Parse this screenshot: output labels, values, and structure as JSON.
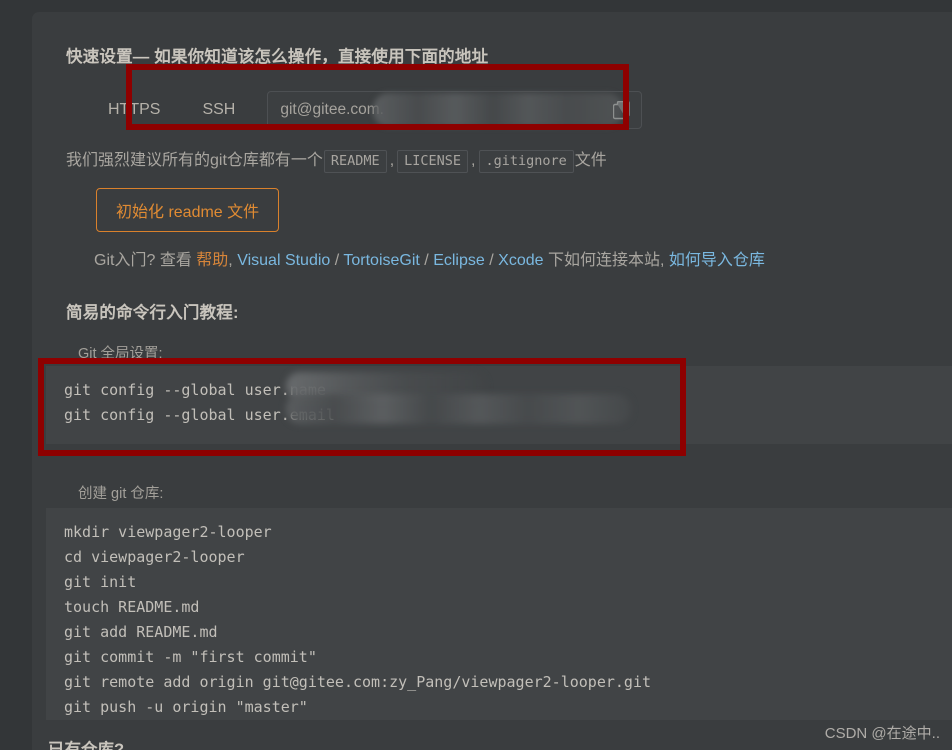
{
  "quick_setup": {
    "title": "快速设置— 如果你知道该怎么操作，直接使用下面的地址",
    "protocol_tabs": [
      {
        "label": "HTTPS",
        "selected": false
      },
      {
        "label": "SSH",
        "selected": true
      }
    ],
    "clone_url_value": "git@gitee.com.",
    "clone_url_redacted": true,
    "copy_icon": "copy-icon"
  },
  "recommend": {
    "prefix": "我们强烈建议所有的git仓库都有一个",
    "tags": [
      "README",
      "LICENSE",
      ".gitignore"
    ],
    "separator": ",",
    "suffix": "文件"
  },
  "init_readme_button": {
    "label": "初始化 readme 文件",
    "accent_color": "#e08b33"
  },
  "help_line": {
    "lead": "Git入门?",
    "view": "查看",
    "help_link": "帮助",
    "comma": ",",
    "ide_links": [
      "Visual Studio",
      "TortoiseGit",
      "Eclipse",
      "Xcode"
    ],
    "ide_separator": "/",
    "tail": "下如何连接本站,",
    "import_link": "如何导入仓库"
  },
  "cli_tutorial": {
    "title": "简易的命令行入门教程:",
    "global_config": {
      "label": "Git 全局设置:",
      "lines": [
        "git config --global user.name",
        "git config --global user.email"
      ],
      "redacted": true
    },
    "create_repo": {
      "label": "创建 git 仓库:",
      "lines": [
        "mkdir viewpager2-looper",
        "cd viewpager2-looper",
        "git init",
        "touch README.md",
        "git add README.md",
        "git commit -m \"first commit\"",
        "git remote add origin git@gitee.com:zy_Pang/viewpager2-looper.git",
        "git push -u origin \"master\""
      ]
    },
    "existing_repo": {
      "label": "已有仓库?"
    }
  },
  "annotations": {
    "color": "#8e0000",
    "boxes": [
      {
        "name": "ssh-url-highlight"
      },
      {
        "name": "git-config-highlight"
      }
    ]
  },
  "watermark": {
    "text": "CSDN @在途中.."
  }
}
